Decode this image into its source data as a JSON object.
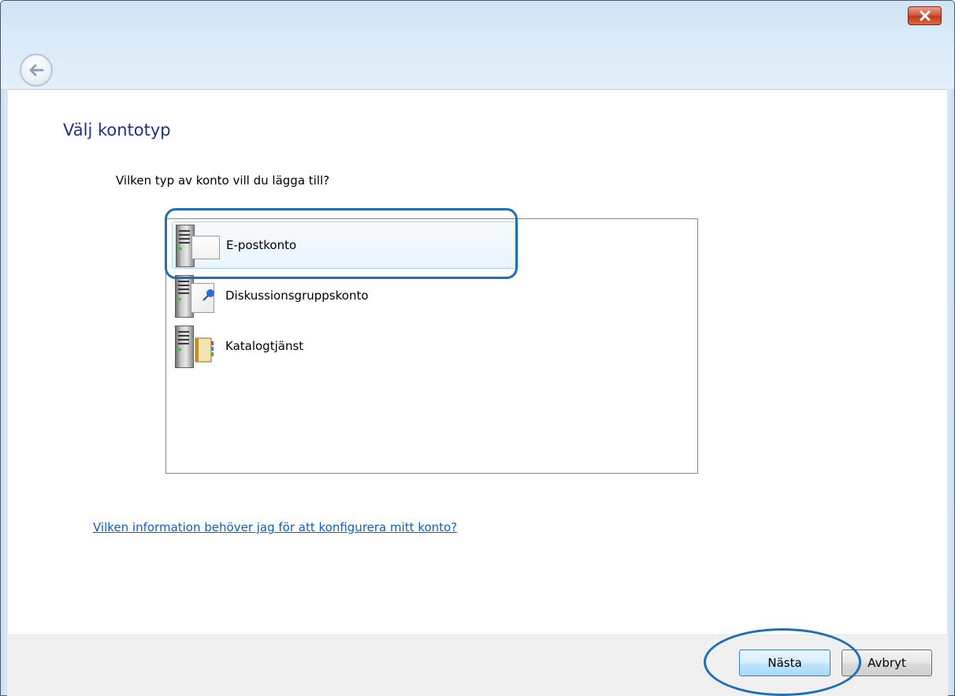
{
  "window": {
    "close_icon": "close-icon",
    "back_icon": "back-arrow-icon"
  },
  "main": {
    "heading": "Välj kontotyp",
    "question": "Vilken typ av konto vill du lägga till?",
    "account_types": [
      {
        "label": "E-postkonto",
        "icon": "email-server-icon",
        "selected": true
      },
      {
        "label": "Diskussionsgruppskonto",
        "icon": "newsgroup-server-icon",
        "selected": false
      },
      {
        "label": "Katalogtjänst",
        "icon": "directory-server-icon",
        "selected": false
      }
    ],
    "help_link": "Vilken information behöver jag för att konfigurera mitt konto?"
  },
  "footer": {
    "next_label": "Nästa",
    "cancel_label": "Avbryt"
  },
  "colors": {
    "heading": "#1e3287",
    "link": "#0a60c8",
    "annotation": "#1e6fb8",
    "close_button": "#c23a1c"
  }
}
